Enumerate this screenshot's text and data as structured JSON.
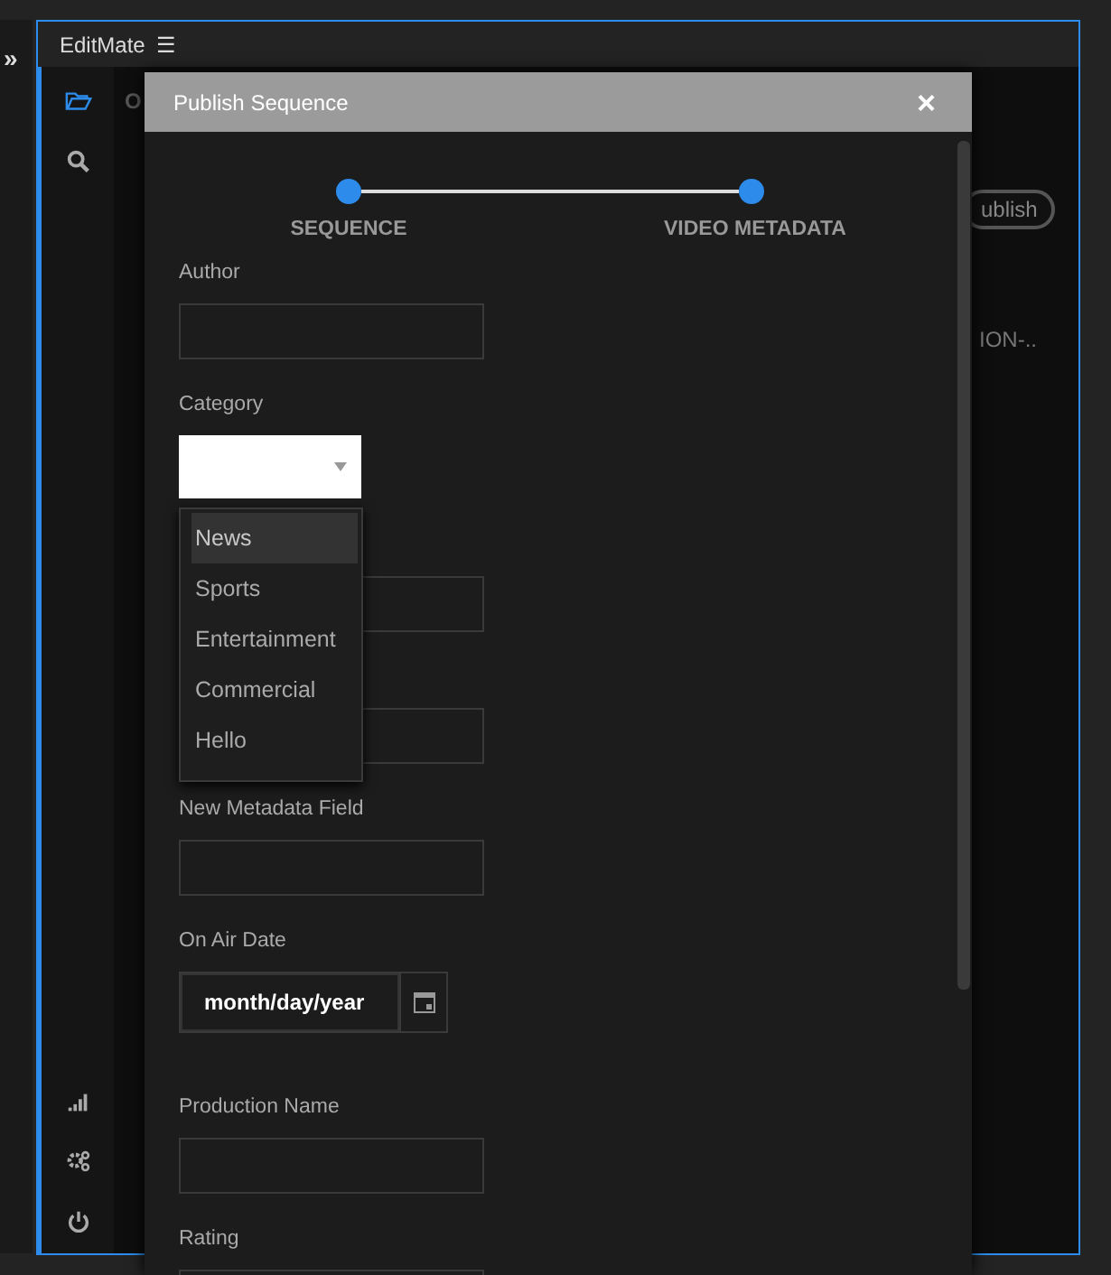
{
  "app": {
    "title": "EditMate",
    "menu_glyph": "☰",
    "expand_glyph": "»"
  },
  "sidebar": {
    "items": [
      {
        "kind": "folder",
        "selected": true
      },
      {
        "kind": "search",
        "selected": false
      }
    ],
    "bottom_items": [
      {
        "kind": "signal"
      },
      {
        "kind": "gears"
      },
      {
        "kind": "power"
      }
    ]
  },
  "background": {
    "tab_letter": "O",
    "publish_button": "ublish",
    "cell_text": "ION-.."
  },
  "dialog": {
    "title": "Publish Sequence",
    "close_glyph": "×",
    "steps": [
      {
        "label": "SEQUENCE",
        "done": true
      },
      {
        "label": "VIDEO METADATA",
        "done": true
      }
    ],
    "fields": [
      {
        "kind": "text",
        "label": "Author"
      },
      {
        "kind": "select",
        "label": "Category",
        "open": true,
        "options": [
          {
            "label": "News",
            "selected": true
          },
          {
            "label": "Sports",
            "selected": false
          },
          {
            "label": "Entertainment",
            "selected": false
          },
          {
            "label": "Commercial",
            "selected": false
          },
          {
            "label": "Hello",
            "selected": false
          }
        ]
      },
      {
        "kind": "text"
      },
      {
        "kind": "text"
      },
      {
        "kind": "text",
        "label": "New Metadata Field"
      },
      {
        "kind": "date",
        "label": "On Air Date",
        "value": "month/day/year"
      },
      {
        "kind": "text",
        "label": "Production Name"
      },
      {
        "kind": "text",
        "label": "Rating"
      }
    ]
  }
}
